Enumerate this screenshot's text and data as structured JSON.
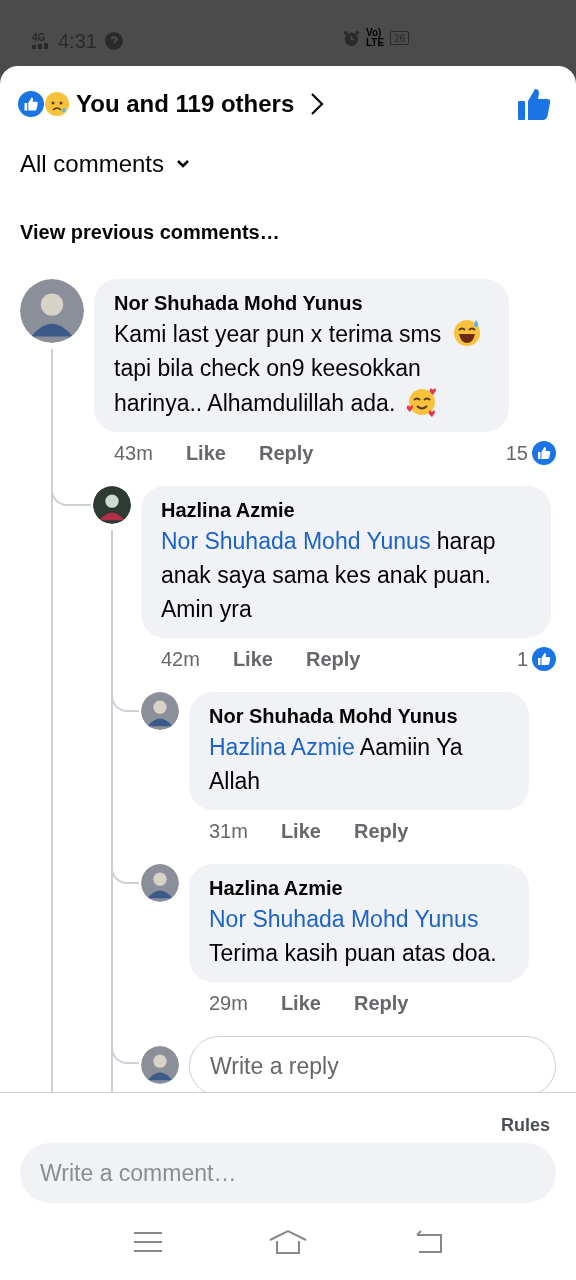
{
  "status_bar": {
    "network": "4G",
    "time": "4:31",
    "volte_top": "Vo)",
    "volte_bottom": "LTE",
    "battery": "26"
  },
  "reactions": {
    "summary": "You and 119 others"
  },
  "filter": {
    "label": "All comments"
  },
  "view_previous": "View previous comments…",
  "comments": [
    {
      "name": "Nor Shuhada Mohd Yunus",
      "body": [
        {
          "kind": "text",
          "text": "Kami last year pun x terima sms"
        },
        {
          "kind": "grin_sweat"
        },
        {
          "kind": "text",
          "text": "tapi bila check on9 keesokkan harinya.. Alhamdulillah ada."
        },
        {
          "kind": "heart_smile"
        }
      ],
      "time": "43m",
      "like": "Like",
      "reply": "Reply",
      "like_count": "15",
      "children": [
        {
          "name": "Hazlina Azmie",
          "body": [
            {
              "kind": "mention",
              "text": "Nor Shuhada Mohd Yunus"
            },
            {
              "kind": "text",
              "text": "harap anak saya sama kes anak puan. Amin yra"
            }
          ],
          "time": "42m",
          "like": "Like",
          "reply": "Reply",
          "like_count": "1",
          "children": [
            {
              "name": "Nor Shuhada Mohd Yunus",
              "body": [
                {
                  "kind": "mention",
                  "text": "Hazlina Azmie"
                },
                {
                  "kind": "text",
                  "text": "Aamiin Ya Allah"
                }
              ],
              "time": "31m",
              "like": "Like",
              "reply": "Reply"
            },
            {
              "name": "Hazlina Azmie",
              "body": [
                {
                  "kind": "mention",
                  "text": "Nor Shuhada Mohd Yunus"
                },
                {
                  "kind": "text",
                  "text": "Terima kasih puan atas doa."
                }
              ],
              "time": "29m",
              "like": "Like",
              "reply": "Reply"
            }
          ],
          "reply_box": {
            "placeholder": "Write a reply"
          }
        }
      ]
    }
  ],
  "rules": "Rules",
  "comment_field": {
    "placeholder": "Write a comment…"
  }
}
